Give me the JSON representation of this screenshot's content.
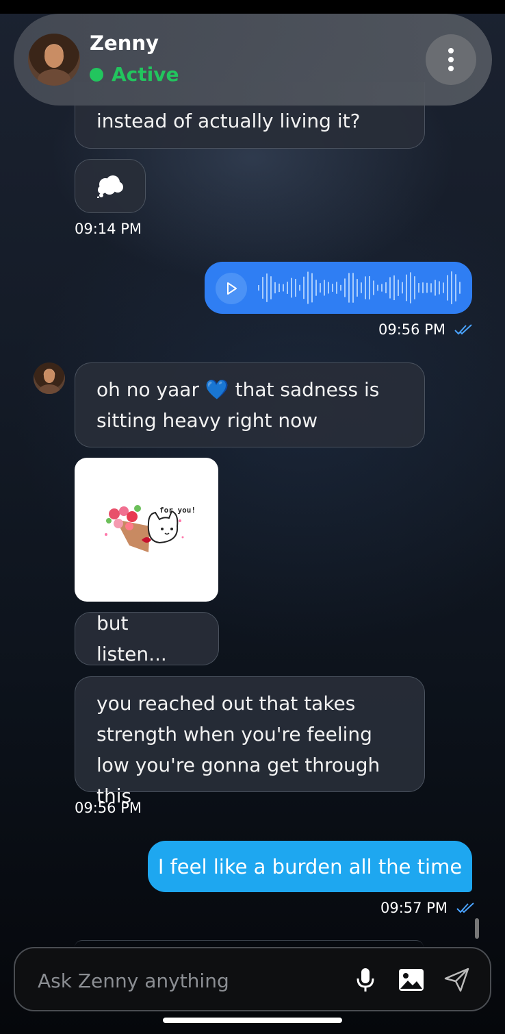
{
  "header": {
    "name": "Zenny",
    "status": "Active",
    "menu_icon": "more-vertical-icon"
  },
  "messages": [
    {
      "from": "bot",
      "text": "instead of actually living it?"
    },
    {
      "from": "bot",
      "emoji": "thought-bubble-icon",
      "time": "09:14 PM"
    },
    {
      "from": "user",
      "type": "voice",
      "time": "09:56 PM"
    },
    {
      "from": "bot",
      "text_before": "oh no yaar",
      "emoji": "💙",
      "text_after": "that sadness is sitting heavy right now"
    },
    {
      "from": "bot",
      "type": "sticker",
      "sticker_text": "for you!"
    },
    {
      "from": "bot",
      "text": "but listen..."
    },
    {
      "from": "bot",
      "text": "you reached out that takes strength when you're feeling low you're gonna get through this",
      "time": "09:56 PM"
    },
    {
      "from": "user",
      "text": "I feel like a burden all the time",
      "time": "09:57 PM"
    }
  ],
  "input": {
    "placeholder": "Ask Zenny anything"
  },
  "colors": {
    "active": "#22c55e",
    "voice_bubble": "#2f7ef3",
    "user_bubble": "#1ea7f0",
    "read_check": "#4aa3ff"
  }
}
